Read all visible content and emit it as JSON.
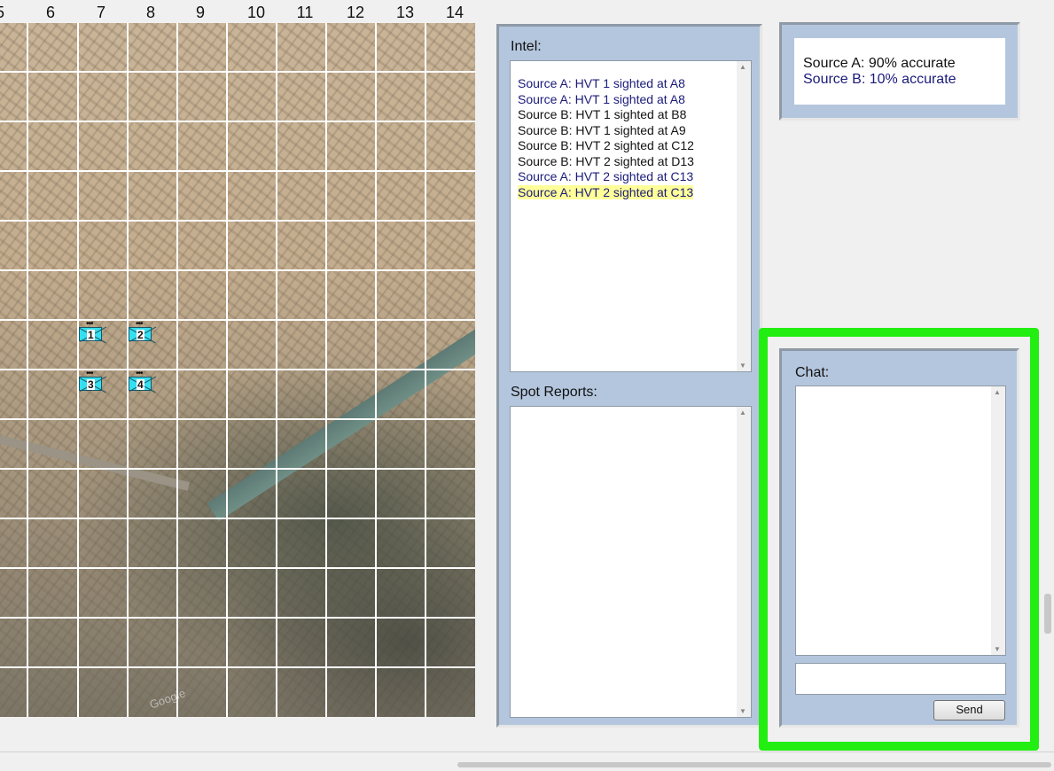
{
  "map": {
    "column_headers": [
      "5",
      "6",
      "7",
      "8",
      "9",
      "10",
      "11",
      "12",
      "13",
      "14"
    ],
    "units": [
      "1",
      "2",
      "3",
      "4"
    ],
    "watermark": "Google"
  },
  "intel": {
    "label": "Intel:",
    "entries": [
      {
        "text": "Source A: HVT 1 sighted at A8",
        "color": "#1a1a7a"
      },
      {
        "text": "Source A: HVT 1 sighted at A8",
        "color": "#1a1a7a"
      },
      {
        "text": "Source B: HVT 1 sighted at B8",
        "color": "#111111"
      },
      {
        "text": "Source B: HVT 1 sighted at A9",
        "color": "#111111"
      },
      {
        "text": "Source B: HVT 2 sighted at C12",
        "color": "#111111"
      },
      {
        "text": "Source B: HVT 2 sighted at D13",
        "color": "#111111"
      },
      {
        "text": "Source A: HVT 2 sighted at C13",
        "color": "#1a1a7a"
      },
      {
        "text": "Source A: HVT 2 sighted at C13",
        "color": "#1a1a7a",
        "highlighted": true
      }
    ]
  },
  "spot_reports": {
    "label": "Spot Reports:"
  },
  "accuracy": {
    "source_a": "Source A:  90% accurate",
    "source_b": "Source B:  10% accurate",
    "source_a_color": "#111111",
    "source_b_color": "#1a1a7a"
  },
  "chat": {
    "label": "Chat:",
    "input_value": "",
    "send_label": "Send",
    "highlight_color": "#22ee11"
  }
}
